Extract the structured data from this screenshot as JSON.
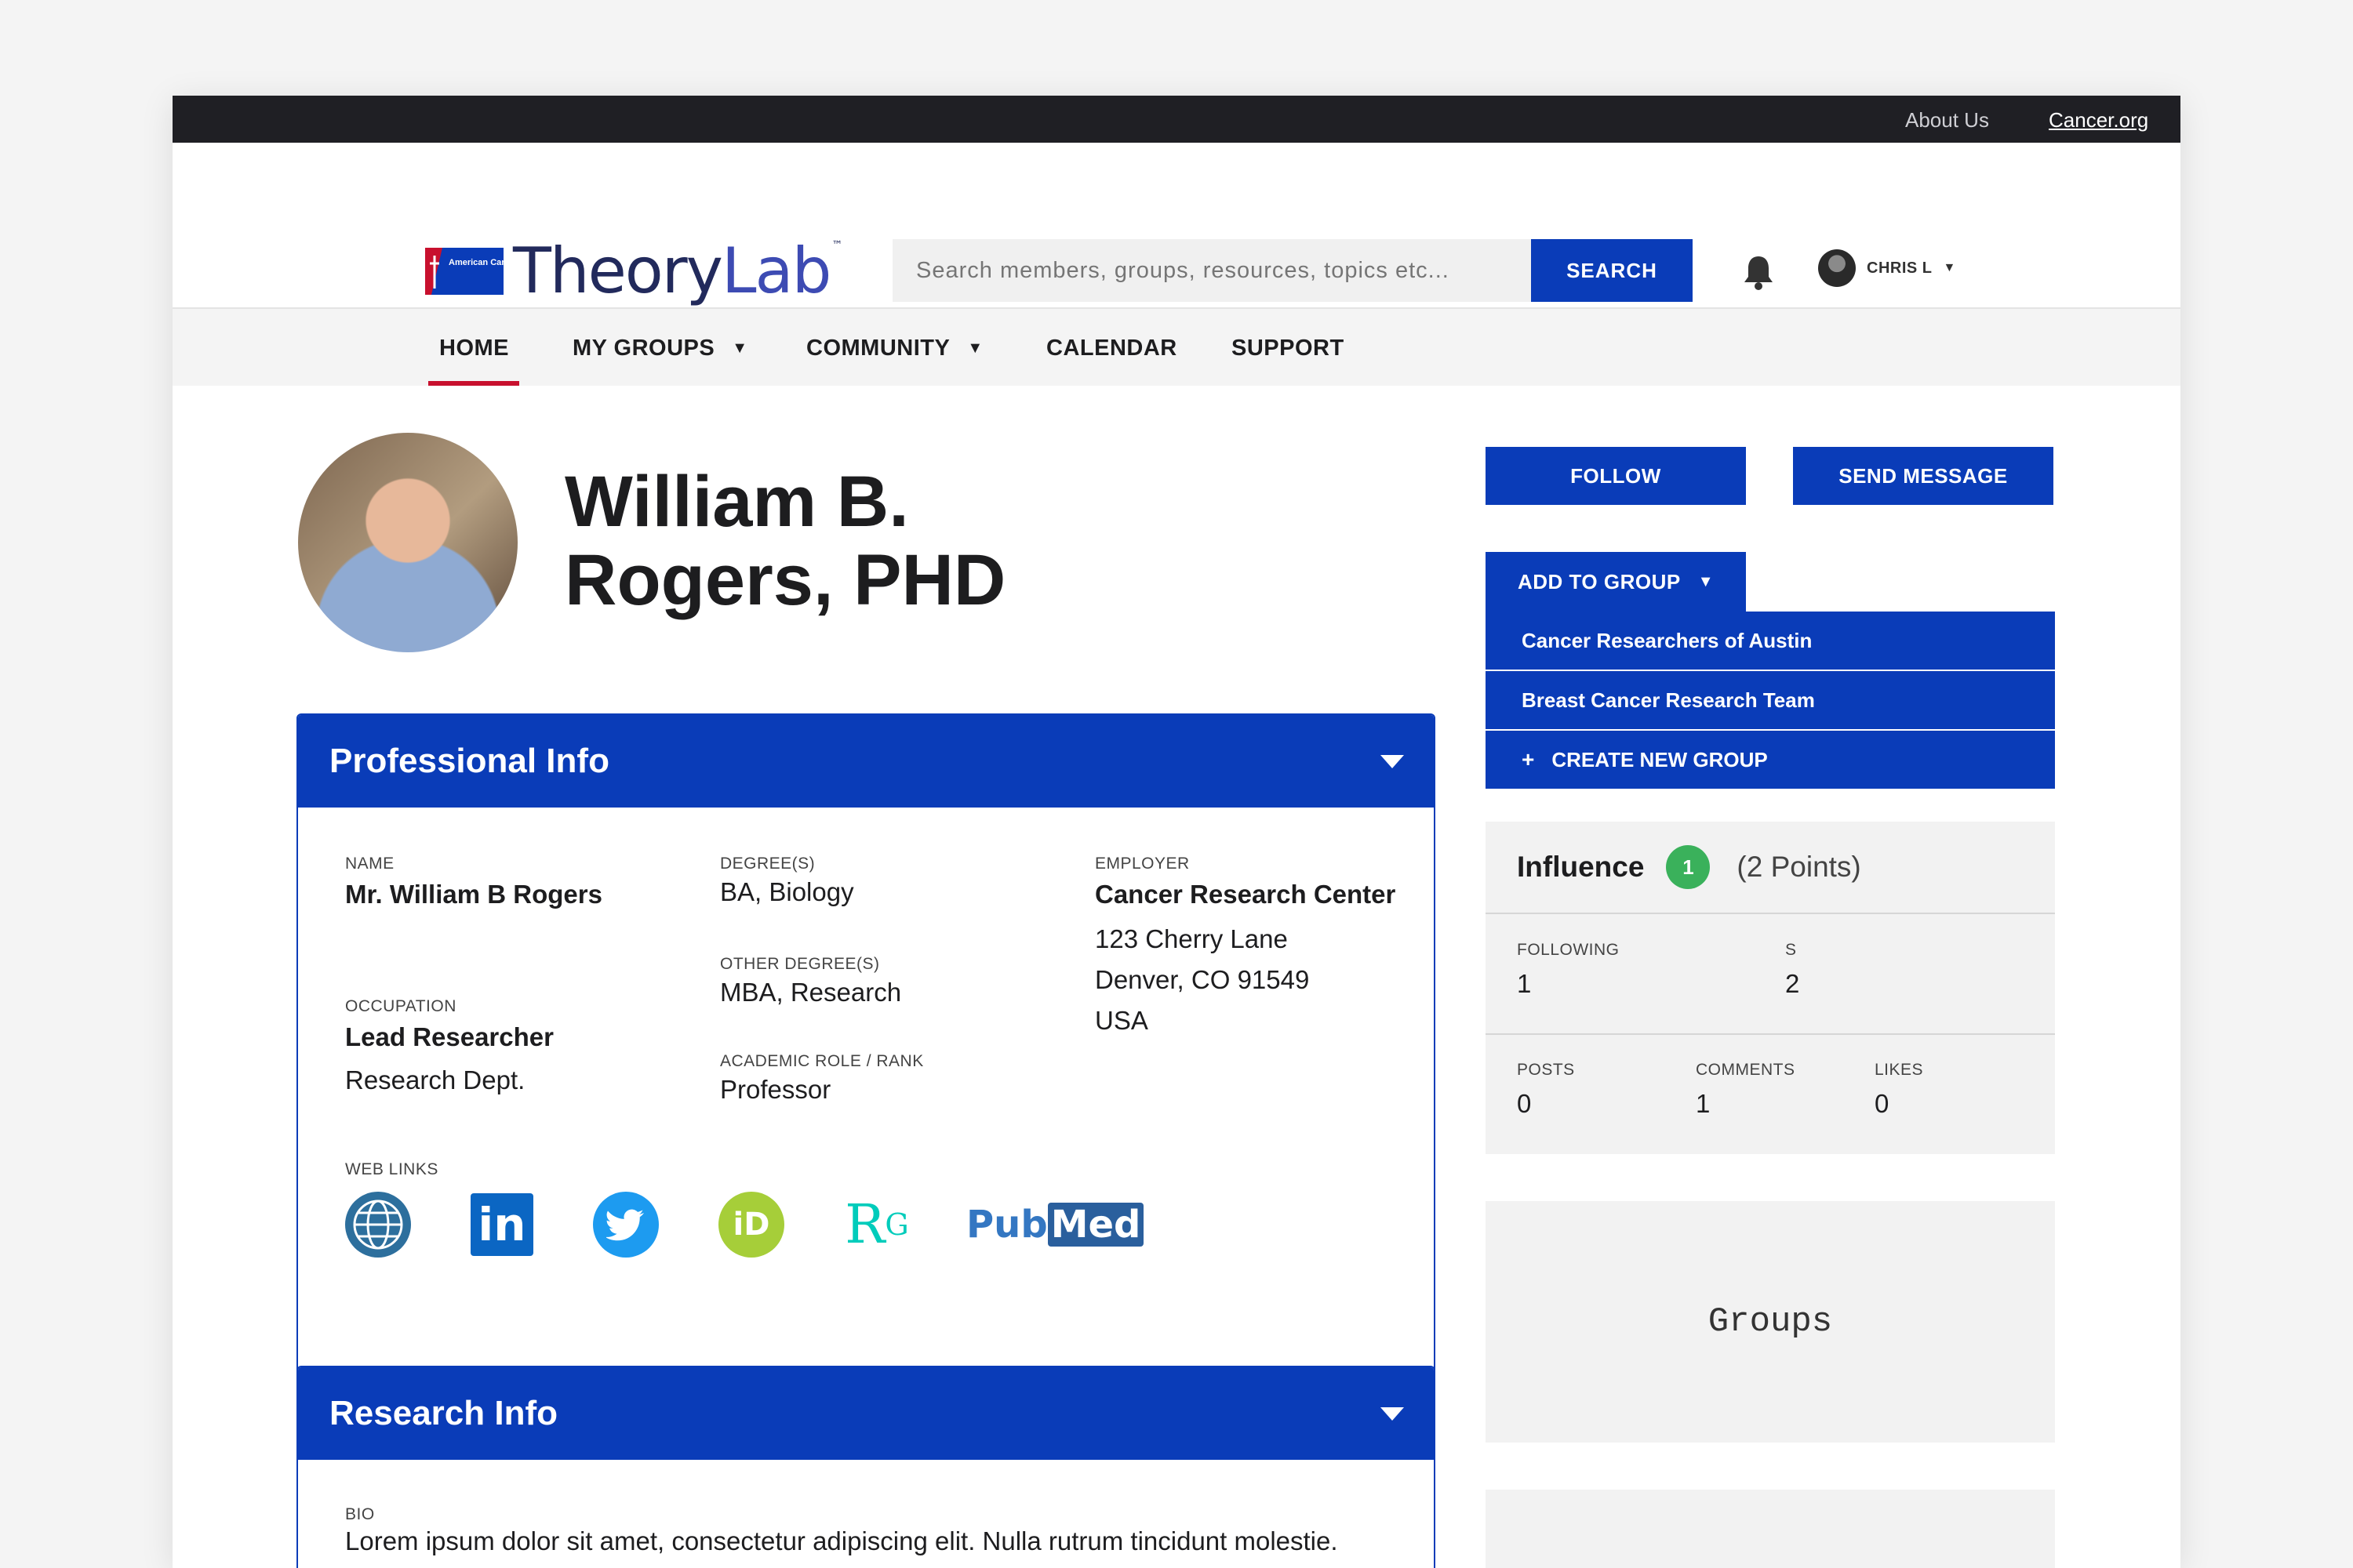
{
  "topbar": {
    "about_label": "About Us",
    "cancer_label": "Cancer.org"
  },
  "header": {
    "logo": {
      "org_text": "American Cancer Society",
      "brand_theory": "Theory",
      "brand_lab": "Lab",
      "trademark": "™"
    },
    "search": {
      "placeholder": "Search members, groups, resources, topics etc...",
      "button_label": "SEARCH"
    },
    "user": {
      "name": "CHRIS L",
      "caret": "▼"
    }
  },
  "nav": {
    "items": [
      {
        "label": "HOME",
        "active": true
      },
      {
        "label": "MY GROUPS",
        "dropdown": true
      },
      {
        "label": "COMMUNITY",
        "dropdown": true
      },
      {
        "label": "CALENDAR"
      },
      {
        "label": "SUPPORT"
      }
    ],
    "caret": "▼"
  },
  "profile": {
    "name_line1": "William B.",
    "name_line2": "Rogers, PHD"
  },
  "actions": {
    "follow_label": "FOLLOW",
    "send_message_label": "SEND MESSAGE",
    "add_to_group_label": "ADD TO GROUP",
    "caret": "▼",
    "groups": [
      "Cancer Researchers of Austin",
      "Breast Cancer Research Team"
    ],
    "create_group_label": "CREATE NEW GROUP",
    "create_group_icon": "+"
  },
  "professional": {
    "title": "Professional Info",
    "name_label": "NAME",
    "name_value": "Mr.  William B Rogers",
    "occupation_label": "OCCUPATION",
    "occupation_value": "Lead Researcher",
    "department": "Research Dept.",
    "degrees_label": "DEGREE(S)",
    "degrees_value": "BA, Biology",
    "other_degrees_label": "OTHER DEGREE(S)",
    "other_degrees_value": "MBA, Research",
    "academic_label": "ACADEMIC ROLE / RANK",
    "academic_value": "Professor",
    "employer_label": "EMPLOYER",
    "employer_name": "Cancer Research Center",
    "employer_address1": "123 Cherry Lane",
    "employer_address2": "Denver, CO 91549",
    "employer_country": "USA",
    "web_links_label": "WEB LINKS",
    "web_links": [
      {
        "icon": "globe-icon"
      },
      {
        "icon": "linkedin-icon",
        "text": "in"
      },
      {
        "icon": "twitter-icon"
      },
      {
        "icon": "orcid-icon",
        "text": "iD"
      },
      {
        "icon": "researchgate-icon",
        "text": "R",
        "sup": "G"
      },
      {
        "icon": "pubmed-icon",
        "text_a": "Pub",
        "text_b": "Med"
      }
    ]
  },
  "influence": {
    "title": "Influence",
    "badge": "1",
    "points": "(2 Points)",
    "stats": [
      {
        "label": "FOLLOWING",
        "value": "1"
      },
      {
        "label": "S",
        "value": "2"
      },
      {
        "label": "POSTS",
        "value": "0"
      },
      {
        "label": "COMMENTS",
        "value": "1"
      },
      {
        "label": "LIKES",
        "value": "0"
      }
    ]
  },
  "groups": {
    "title": "Groups"
  },
  "research": {
    "title": "Research Info",
    "bio_label": "BIO",
    "bio_text": "Lorem ipsum dolor sit amet, consectetur adipiscing elit. Nulla rutrum tincidunt molestie."
  },
  "colors": {
    "primary": "#0a3cb8",
    "accent_red": "#c8102e",
    "success": "#3ab15b",
    "topbar": "#1f1f24"
  }
}
